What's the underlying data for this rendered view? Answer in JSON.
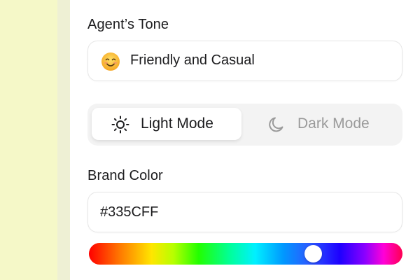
{
  "tone": {
    "label": "Agent’s Tone",
    "value": "Friendly and Casual",
    "icon": "smiling-face-emoji"
  },
  "mode_toggle": {
    "selected": "light",
    "options": [
      {
        "id": "light",
        "label": "Light Mode",
        "icon": "sun-icon"
      },
      {
        "id": "dark",
        "label": "Dark Mode",
        "icon": "moon-icon"
      }
    ]
  },
  "brand_color": {
    "label": "Brand Color",
    "value": "#335CFF",
    "hue_position": 0.715
  },
  "colors": {
    "left_background": "#f5f8c8",
    "panel_background": "#ffffff",
    "text_primary": "#1c1c1e",
    "text_muted": "#9a9a9a",
    "toggle_background": "#f3f3f3"
  }
}
